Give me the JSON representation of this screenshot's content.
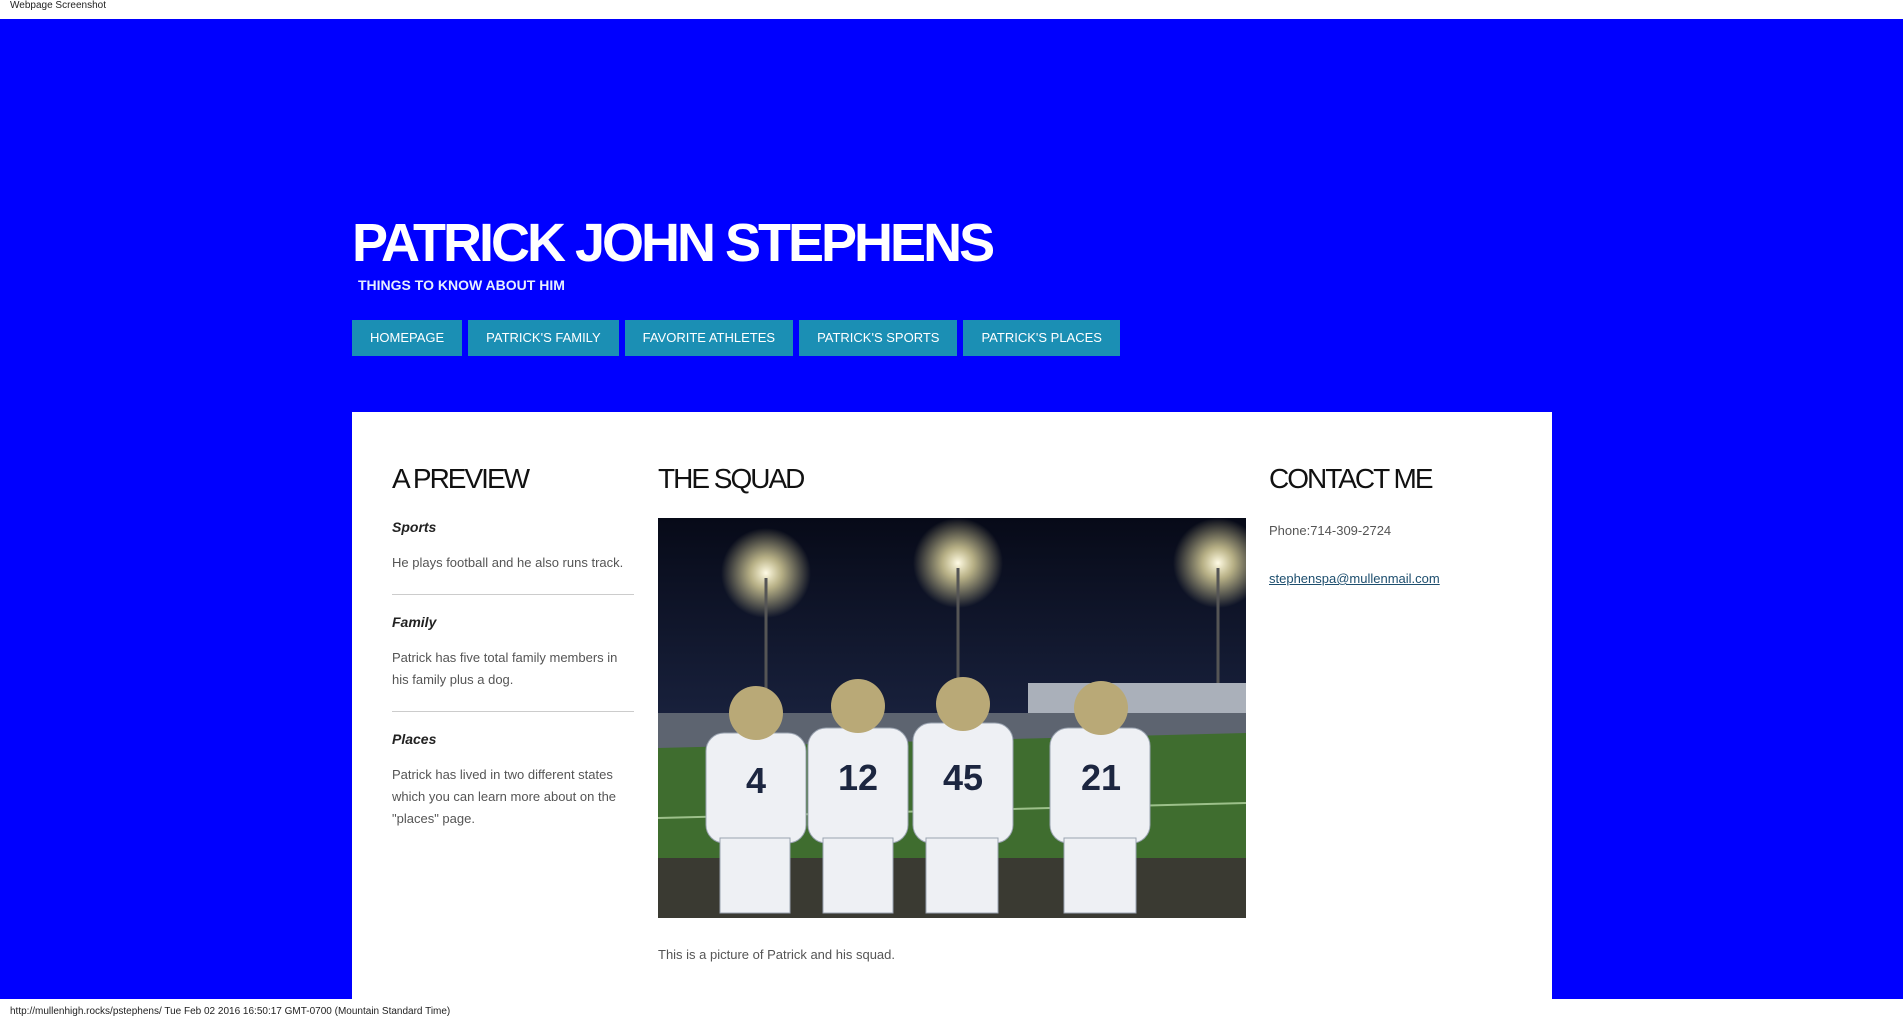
{
  "capture": {
    "title": "Webpage Screenshot",
    "status_line": "http://mullenhigh.rocks/pstephens/ Tue Feb 02 2016 16:50:17 GMT-0700 (Mountain Standard Time)"
  },
  "site": {
    "title": "PATRICK JOHN STEPHENS",
    "tagline": "THINGS TO KNOW ABOUT HIM",
    "background_color": "#0000ff",
    "nav_color": "#1b8fb4"
  },
  "nav": [
    {
      "label": "HOMEPAGE"
    },
    {
      "label": "PATRICK'S FAMILY"
    },
    {
      "label": "FAVORITE ATHLETES"
    },
    {
      "label": "PATRICK'S SPORTS"
    },
    {
      "label": "PATRICK'S PLACES"
    }
  ],
  "preview": {
    "heading": "A PREVIEW",
    "items": [
      {
        "title": "Sports",
        "text": "He plays football and he also runs track."
      },
      {
        "title": "Family",
        "text": "Patrick has five total family members in his family plus a dog."
      },
      {
        "title": "Places",
        "text": "Patrick has lived in two different states which you can learn more about on the \"places\" page."
      }
    ]
  },
  "squad": {
    "heading": "THE SQUAD",
    "jerseys": [
      "4",
      "12",
      "45",
      "21"
    ],
    "caption": "This is a picture of Patrick and his squad."
  },
  "contact": {
    "heading": "CONTACT ME",
    "phone": "Phone:714-309-2724",
    "email": "stephenspa@mullenmail.com"
  }
}
